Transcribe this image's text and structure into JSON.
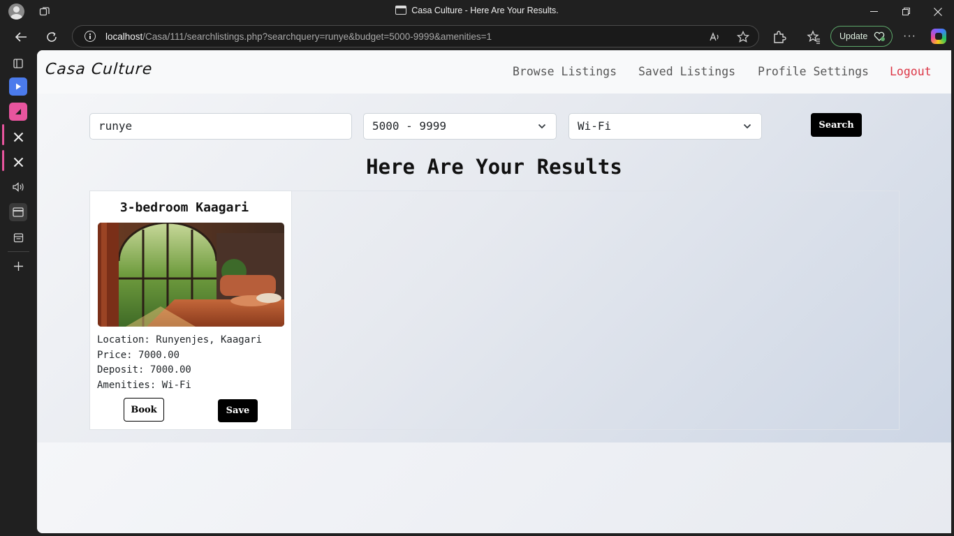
{
  "browser": {
    "tab_title": "Casa Culture - Here Are Your Results.",
    "url_host": "localhost",
    "url_path": "/Casa/111/searchlistings.php?searchquery=runye&budget=5000-9999&amenities=1",
    "update_label": "Update",
    "accent_color": "#e8559e",
    "update_color": "#5da86a"
  },
  "navbar": {
    "brand": "Casa Culture",
    "links": [
      "Browse Listings",
      "Saved Listings",
      "Profile Settings"
    ],
    "logout": "Logout",
    "logout_color": "#dc3545"
  },
  "search": {
    "query": "runye",
    "budget": "5000 - 9999",
    "amenity": "Wi-Fi",
    "button": "Search"
  },
  "results": {
    "heading": "Here Are Your Results",
    "listings": [
      {
        "title": "3-bedroom Kaagari",
        "image": "bedroom-photo",
        "location": "Location: Runyenjes, Kaagari",
        "price": "Price: 7000.00",
        "deposit": "Deposit: 7000.00",
        "amenities": "Amenities: Wi-Fi",
        "book_label": "Book",
        "save_label": "Save"
      }
    ]
  }
}
